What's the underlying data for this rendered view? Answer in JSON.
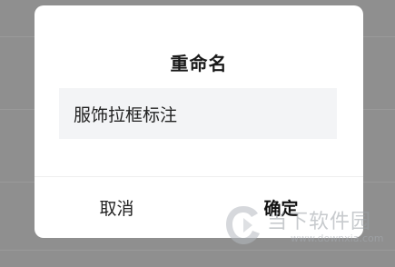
{
  "dialog": {
    "title": "重命名",
    "input_value": "服饰拉框标注",
    "cancel_label": "取消",
    "confirm_label": "确定"
  },
  "watermark": {
    "site_name": "当下软件园",
    "url": "www.downxia.com"
  },
  "colors": {
    "overlay": "#8f8f8f",
    "dialog_bg": "#ffffff",
    "field_bg": "#f3f4f6",
    "text": "#1a1a1a"
  }
}
